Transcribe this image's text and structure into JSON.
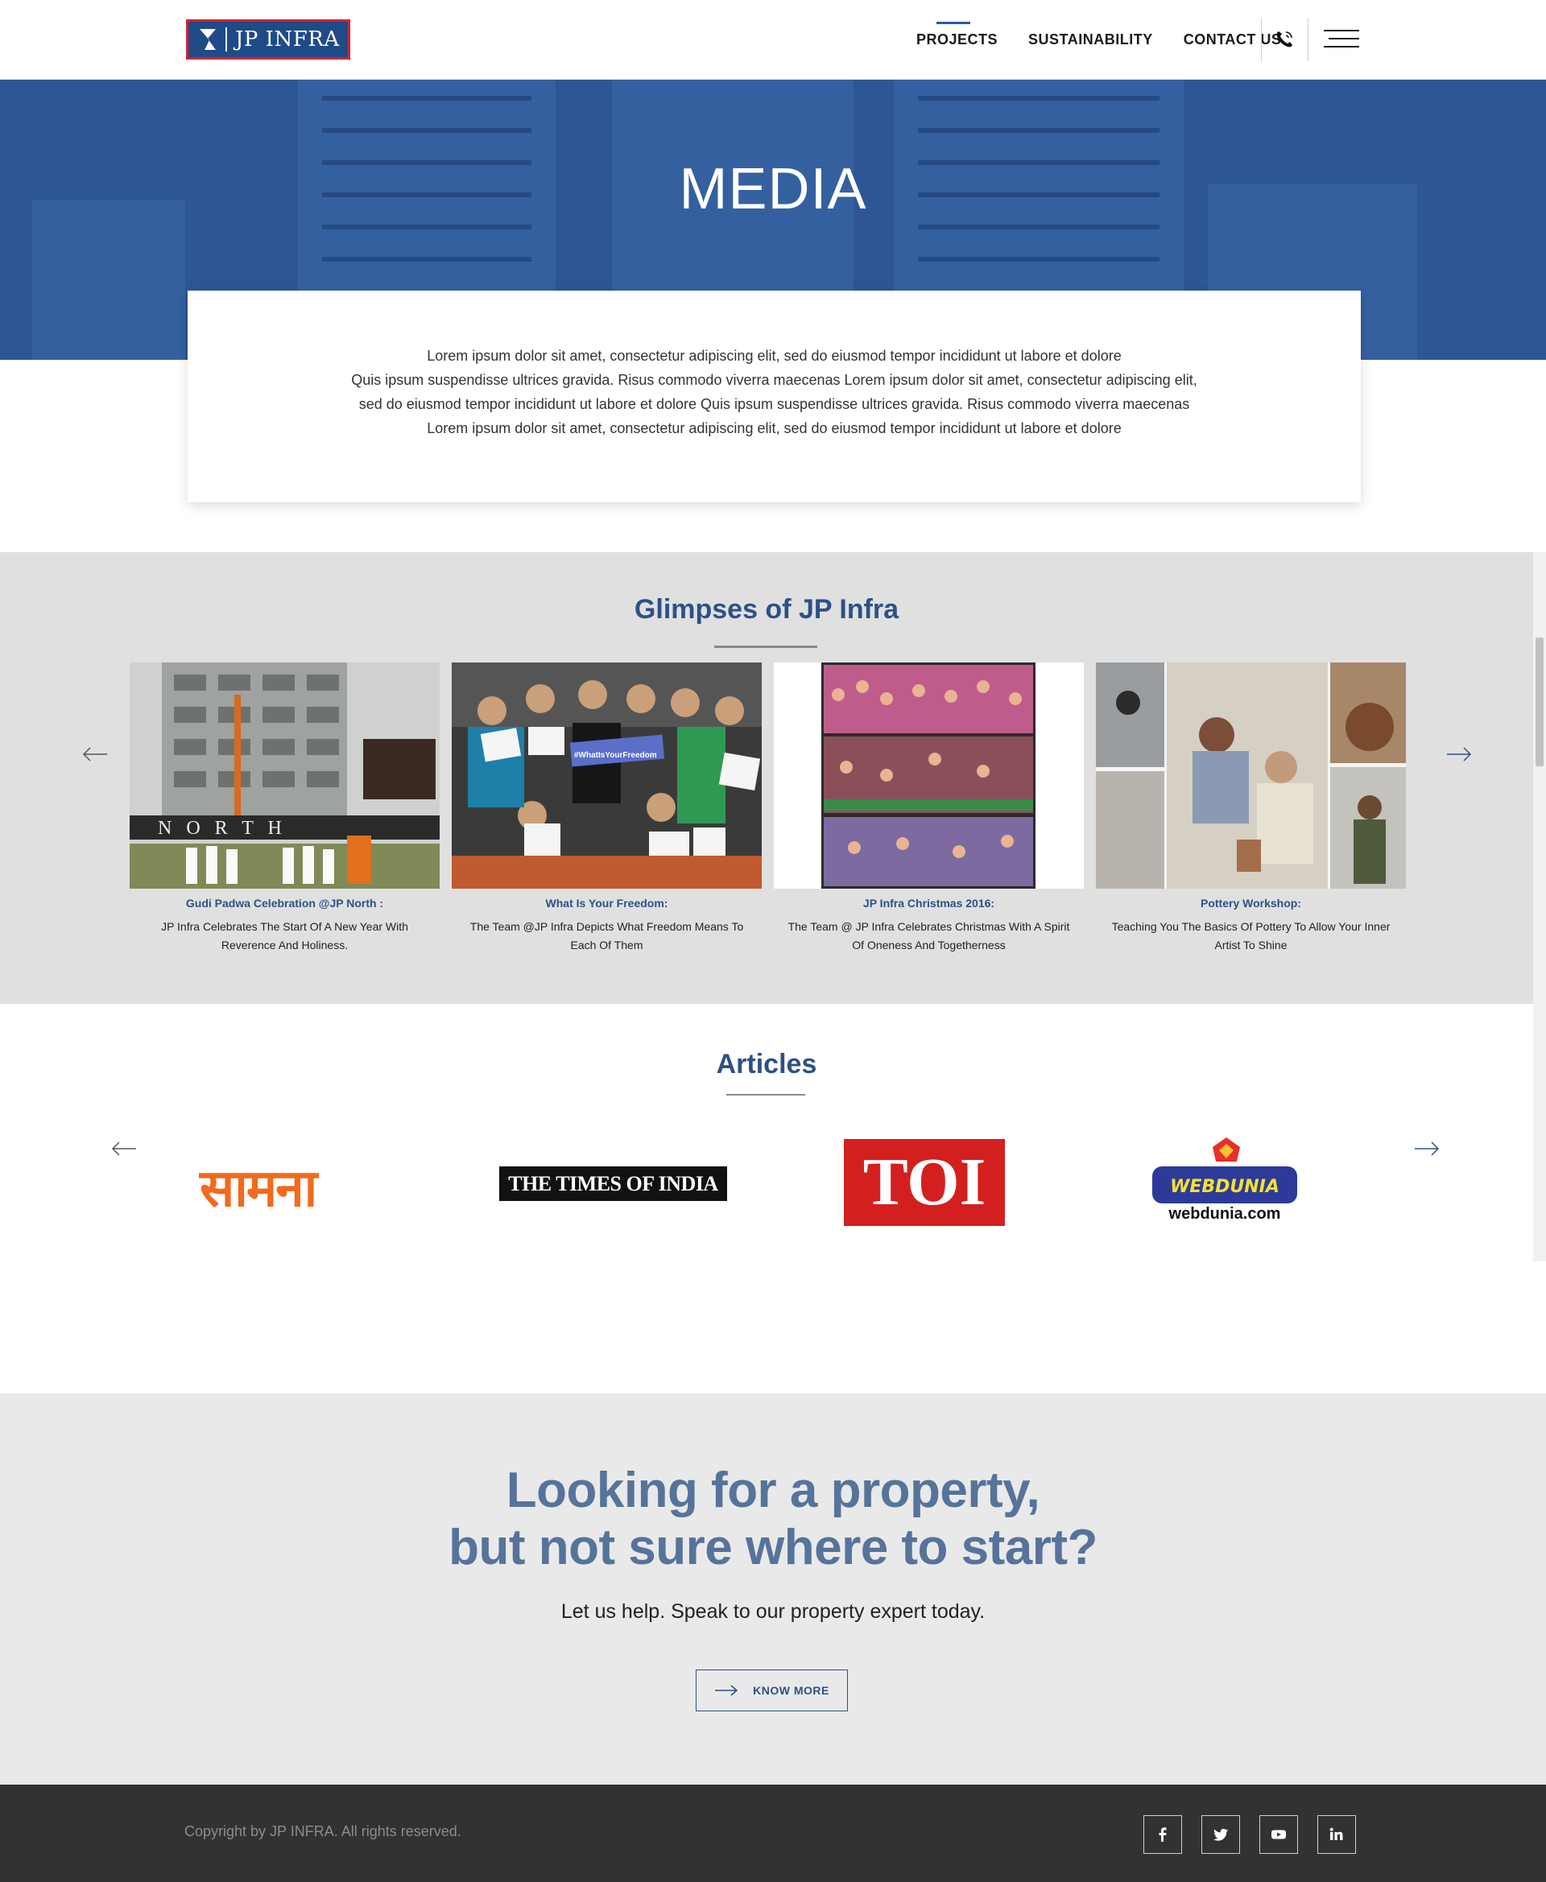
{
  "header": {
    "logo_text": "JP INFRA",
    "nav": [
      {
        "label": "PROJECTS",
        "active": true
      },
      {
        "label": "SUSTAINABILITY",
        "active": false
      },
      {
        "label": "CONTACT US",
        "active": false
      }
    ],
    "icons": {
      "phone": "phone-icon",
      "menu": "hamburger-menu-icon"
    }
  },
  "hero": {
    "title": "MEDIA",
    "intro_lines": [
      "Lorem ipsum dolor sit amet, consectetur adipiscing elit, sed do eiusmod tempor incididunt ut labore et dolore",
      "Quis ipsum suspendisse ultrices gravida. Risus commodo viverra maecenas Lorem ipsum dolor sit amet, consectetur adipiscing elit,",
      "sed do eiusmod tempor incididunt ut labore et dolore Quis ipsum suspendisse ultrices gravida. Risus commodo viverra maecenas",
      "Lorem ipsum dolor sit amet, consectetur adipiscing elit, sed do eiusmod tempor incididunt ut labore et dolore"
    ]
  },
  "glimpses": {
    "title": "Glimpses of JP Infra",
    "cards": [
      {
        "title": "Gudi Padwa Celebration @JP North :",
        "desc": "JP Infra Celebrates The Start Of A New Year With Reverence And Holiness."
      },
      {
        "title": "What Is Your Freedom:",
        "desc": "The Team @JP Infra Depicts What Freedom Means To Each Of Them"
      },
      {
        "title": "JP Infra Christmas 2016:",
        "desc": "The Team @ JP Infra Celebrates Christmas With A Spirit Of Oneness And Togetherness"
      },
      {
        "title": "Pottery Workshop:",
        "desc": "Teaching You The Basics Of Pottery To Allow Your Inner Artist To Shine"
      }
    ],
    "photo_text": {
      "north_sign": "N O R T H",
      "freedom_sign": "#WhatIsYourFreedom"
    }
  },
  "articles": {
    "title": "Articles",
    "logos": {
      "saamana": "सामना",
      "times_of_india": "THE TIMES OF INDIA",
      "toi": "TOI",
      "webdunia_badge": "WEBDUNIA",
      "webdunia_url": "webdunia.com"
    }
  },
  "cta": {
    "heading_line1": "Looking for a property,",
    "heading_line2": "but not sure where to start?",
    "subtext": "Let us help. Speak to our property expert today.",
    "button_label": "KNOW MORE"
  },
  "footer": {
    "copyright": "Copyright by JP INFRA. All rights reserved.",
    "social": [
      "facebook-icon",
      "twitter-icon",
      "youtube-icon",
      "linkedin-icon"
    ]
  },
  "colors": {
    "brand_blue": "#2d5186",
    "hero_blue": "#2e5695",
    "logo_red": "#d6212f",
    "footer_bg": "#323232"
  }
}
